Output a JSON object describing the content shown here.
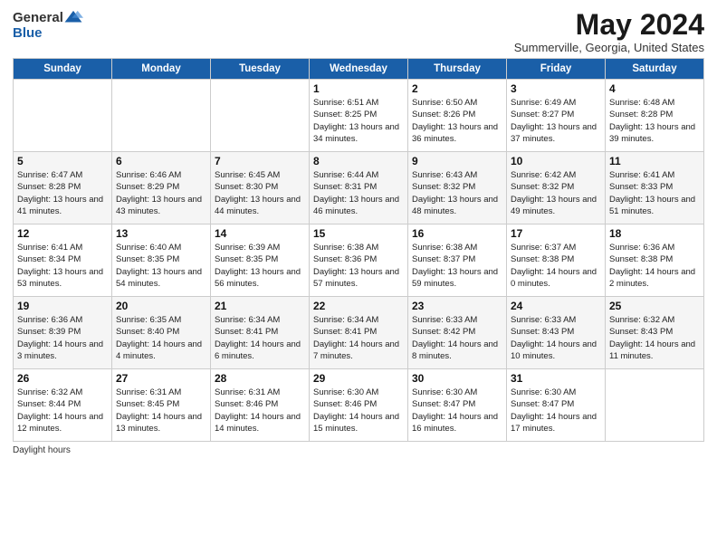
{
  "header": {
    "logo_general": "General",
    "logo_blue": "Blue",
    "month_title": "May 2024",
    "subtitle": "Summerville, Georgia, United States"
  },
  "days_of_week": [
    "Sunday",
    "Monday",
    "Tuesday",
    "Wednesday",
    "Thursday",
    "Friday",
    "Saturday"
  ],
  "weeks": [
    [
      {
        "day": "",
        "sunrise": "",
        "sunset": "",
        "daylight": ""
      },
      {
        "day": "",
        "sunrise": "",
        "sunset": "",
        "daylight": ""
      },
      {
        "day": "",
        "sunrise": "",
        "sunset": "",
        "daylight": ""
      },
      {
        "day": "1",
        "sunrise": "Sunrise: 6:51 AM",
        "sunset": "Sunset: 8:25 PM",
        "daylight": "Daylight: 13 hours and 34 minutes."
      },
      {
        "day": "2",
        "sunrise": "Sunrise: 6:50 AM",
        "sunset": "Sunset: 8:26 PM",
        "daylight": "Daylight: 13 hours and 36 minutes."
      },
      {
        "day": "3",
        "sunrise": "Sunrise: 6:49 AM",
        "sunset": "Sunset: 8:27 PM",
        "daylight": "Daylight: 13 hours and 37 minutes."
      },
      {
        "day": "4",
        "sunrise": "Sunrise: 6:48 AM",
        "sunset": "Sunset: 8:28 PM",
        "daylight": "Daylight: 13 hours and 39 minutes."
      }
    ],
    [
      {
        "day": "5",
        "sunrise": "Sunrise: 6:47 AM",
        "sunset": "Sunset: 8:28 PM",
        "daylight": "Daylight: 13 hours and 41 minutes."
      },
      {
        "day": "6",
        "sunrise": "Sunrise: 6:46 AM",
        "sunset": "Sunset: 8:29 PM",
        "daylight": "Daylight: 13 hours and 43 minutes."
      },
      {
        "day": "7",
        "sunrise": "Sunrise: 6:45 AM",
        "sunset": "Sunset: 8:30 PM",
        "daylight": "Daylight: 13 hours and 44 minutes."
      },
      {
        "day": "8",
        "sunrise": "Sunrise: 6:44 AM",
        "sunset": "Sunset: 8:31 PM",
        "daylight": "Daylight: 13 hours and 46 minutes."
      },
      {
        "day": "9",
        "sunrise": "Sunrise: 6:43 AM",
        "sunset": "Sunset: 8:32 PM",
        "daylight": "Daylight: 13 hours and 48 minutes."
      },
      {
        "day": "10",
        "sunrise": "Sunrise: 6:42 AM",
        "sunset": "Sunset: 8:32 PM",
        "daylight": "Daylight: 13 hours and 49 minutes."
      },
      {
        "day": "11",
        "sunrise": "Sunrise: 6:41 AM",
        "sunset": "Sunset: 8:33 PM",
        "daylight": "Daylight: 13 hours and 51 minutes."
      }
    ],
    [
      {
        "day": "12",
        "sunrise": "Sunrise: 6:41 AM",
        "sunset": "Sunset: 8:34 PM",
        "daylight": "Daylight: 13 hours and 53 minutes."
      },
      {
        "day": "13",
        "sunrise": "Sunrise: 6:40 AM",
        "sunset": "Sunset: 8:35 PM",
        "daylight": "Daylight: 13 hours and 54 minutes."
      },
      {
        "day": "14",
        "sunrise": "Sunrise: 6:39 AM",
        "sunset": "Sunset: 8:35 PM",
        "daylight": "Daylight: 13 hours and 56 minutes."
      },
      {
        "day": "15",
        "sunrise": "Sunrise: 6:38 AM",
        "sunset": "Sunset: 8:36 PM",
        "daylight": "Daylight: 13 hours and 57 minutes."
      },
      {
        "day": "16",
        "sunrise": "Sunrise: 6:38 AM",
        "sunset": "Sunset: 8:37 PM",
        "daylight": "Daylight: 13 hours and 59 minutes."
      },
      {
        "day": "17",
        "sunrise": "Sunrise: 6:37 AM",
        "sunset": "Sunset: 8:38 PM",
        "daylight": "Daylight: 14 hours and 0 minutes."
      },
      {
        "day": "18",
        "sunrise": "Sunrise: 6:36 AM",
        "sunset": "Sunset: 8:38 PM",
        "daylight": "Daylight: 14 hours and 2 minutes."
      }
    ],
    [
      {
        "day": "19",
        "sunrise": "Sunrise: 6:36 AM",
        "sunset": "Sunset: 8:39 PM",
        "daylight": "Daylight: 14 hours and 3 minutes."
      },
      {
        "day": "20",
        "sunrise": "Sunrise: 6:35 AM",
        "sunset": "Sunset: 8:40 PM",
        "daylight": "Daylight: 14 hours and 4 minutes."
      },
      {
        "day": "21",
        "sunrise": "Sunrise: 6:34 AM",
        "sunset": "Sunset: 8:41 PM",
        "daylight": "Daylight: 14 hours and 6 minutes."
      },
      {
        "day": "22",
        "sunrise": "Sunrise: 6:34 AM",
        "sunset": "Sunset: 8:41 PM",
        "daylight": "Daylight: 14 hours and 7 minutes."
      },
      {
        "day": "23",
        "sunrise": "Sunrise: 6:33 AM",
        "sunset": "Sunset: 8:42 PM",
        "daylight": "Daylight: 14 hours and 8 minutes."
      },
      {
        "day": "24",
        "sunrise": "Sunrise: 6:33 AM",
        "sunset": "Sunset: 8:43 PM",
        "daylight": "Daylight: 14 hours and 10 minutes."
      },
      {
        "day": "25",
        "sunrise": "Sunrise: 6:32 AM",
        "sunset": "Sunset: 8:43 PM",
        "daylight": "Daylight: 14 hours and 11 minutes."
      }
    ],
    [
      {
        "day": "26",
        "sunrise": "Sunrise: 6:32 AM",
        "sunset": "Sunset: 8:44 PM",
        "daylight": "Daylight: 14 hours and 12 minutes."
      },
      {
        "day": "27",
        "sunrise": "Sunrise: 6:31 AM",
        "sunset": "Sunset: 8:45 PM",
        "daylight": "Daylight: 14 hours and 13 minutes."
      },
      {
        "day": "28",
        "sunrise": "Sunrise: 6:31 AM",
        "sunset": "Sunset: 8:46 PM",
        "daylight": "Daylight: 14 hours and 14 minutes."
      },
      {
        "day": "29",
        "sunrise": "Sunrise: 6:30 AM",
        "sunset": "Sunset: 8:46 PM",
        "daylight": "Daylight: 14 hours and 15 minutes."
      },
      {
        "day": "30",
        "sunrise": "Sunrise: 6:30 AM",
        "sunset": "Sunset: 8:47 PM",
        "daylight": "Daylight: 14 hours and 16 minutes."
      },
      {
        "day": "31",
        "sunrise": "Sunrise: 6:30 AM",
        "sunset": "Sunset: 8:47 PM",
        "daylight": "Daylight: 14 hours and 17 minutes."
      },
      {
        "day": "",
        "sunrise": "",
        "sunset": "",
        "daylight": ""
      }
    ]
  ],
  "footer": {
    "daylight_hours_label": "Daylight hours"
  }
}
